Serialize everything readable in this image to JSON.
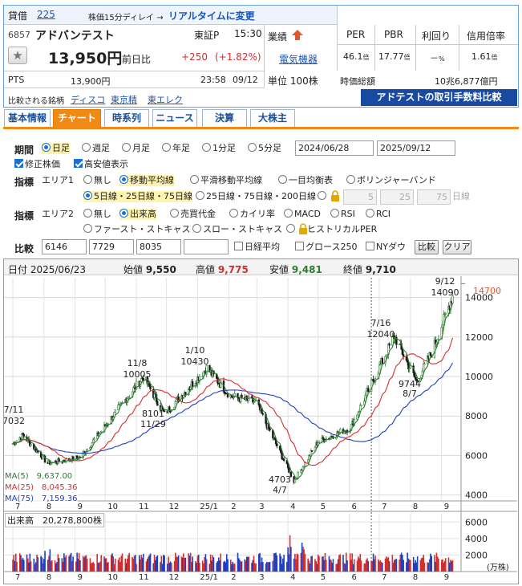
{
  "header": {
    "margin_label": "貸借",
    "margin_code": "225",
    "delay_note": "株価15分ディレイ →",
    "realtime_link": "リアルタイムに変更",
    "code": "6857",
    "name": "アドバンテスト",
    "market": "東証P",
    "time": "15:30",
    "price": "13,950円",
    "change_label": "前日比",
    "change": "+250",
    "change_pct": "(+1.82%)",
    "pts_label": "PTS",
    "pts_price": "13,900円",
    "pts_time": "23:58",
    "pts_date": "09/12",
    "performance_label": "業績",
    "sector": "電気機器",
    "unit": "単位 100株",
    "per_label": "PER",
    "pbr_label": "PBR",
    "yield_label": "利回り",
    "margin_ratio_label": "信用倍率",
    "per": "46.1",
    "pbr": "17.77",
    "yield": "－",
    "margin_ratio": "1.61",
    "ratio_unit": "倍",
    "pct_unit": "%",
    "mcap_label": "時価総額",
    "mcap": "10兆6,877億円",
    "compare_label": "比較される銘柄",
    "compare_1": "ディスコ",
    "compare_2": "東京精",
    "compare_3": "東エレク",
    "fee_banner": "アドテストの取引手数料比較"
  },
  "tabs": [
    "基本情報",
    "チャート",
    "時系列",
    "ニュース",
    "決算",
    "大株主"
  ],
  "controls": {
    "period_label": "期間",
    "periods": [
      "日足",
      "週足",
      "月足",
      "年足",
      "1分足",
      "5分足"
    ],
    "date_from": "2024/06/28",
    "date_to": "2025/09/12",
    "adjusted_label": "修正株価",
    "highlow_label": "高安値表示",
    "indicator_label": "指標",
    "area1_label": "エリア1",
    "area1_opts": [
      "無し",
      "移動平均線",
      "平滑移動平均線",
      "一目均衡表",
      "ボリンジャーバンド"
    ],
    "ma_sets": [
      "5日線・25日線・75日線",
      "25日線・75日線・200日線"
    ],
    "ma_custom": [
      "5",
      "25",
      "75"
    ],
    "day_line": "日線",
    "area2_label": "エリア2",
    "area2_opts": [
      "無し",
      "出来高",
      "売買代金",
      "カイリ率",
      "MACD",
      "RSI",
      "RCI"
    ],
    "area2_opts2": [
      "ファースト・ストキャス",
      "スロー・ストキャス",
      "ヒストリカルPER"
    ],
    "compare_label": "比較",
    "compare_codes": [
      "6146",
      "7729",
      "8035",
      ""
    ],
    "compare_opts": [
      "日経平均",
      "グロース250",
      "NYダウ"
    ],
    "compare_btn": "比較",
    "clear_btn": "クリア"
  },
  "chart_info": {
    "date_label": "日付",
    "date": "2025/06/23",
    "open_label": "始値",
    "open": "9,550",
    "high_label": "高値",
    "high": "9,775",
    "low_label": "安値",
    "low": "9,481",
    "close_label": "終値",
    "close": "9,710",
    "ma5": "MA(5)　9,637.00",
    "ma25": "MA(25)　8,045.36",
    "ma75": "MA(75)　7,159.36",
    "volume_label": "出来高　20,278,800株",
    "vol_unit": "(万株)",
    "current_price_tag": "14700",
    "colors": {
      "up": "#2e7d32",
      "down": "#1a1a1a",
      "ma5": "#2e7d32",
      "ma25": "#d32f2f",
      "ma75": "#1e3fbf",
      "vol_up": "#d32f2f",
      "vol_down": "#1e3fbf",
      "accent": "#f08a14"
    }
  },
  "chart_data": [
    {
      "type": "line",
      "title": "",
      "x": [
        "2024/07/11",
        "2024/08/05",
        "2024/09/06",
        "2024/10/01",
        "2024/11/08",
        "2024/11/29",
        "2025/01/10",
        "2025/02/03",
        "2025/02/28",
        "2025/04/07",
        "2025/05/01",
        "2025/06/02",
        "2025/07/16",
        "2025/08/07",
        "2025/08/22",
        "2025/09/12"
      ],
      "series": [
        {
          "name": "",
          "values": [
            7032,
            5600,
            5900,
            7500,
            10005,
            8101,
            10430,
            9000,
            8700,
            4703,
            6700,
            7400,
            12040,
            9744,
            11200,
            14090
          ]
        }
      ],
      "ylim": [
        3700,
        15000
      ],
      "yticks": [
        4000,
        6000,
        8000,
        10000,
        12000,
        14000
      ],
      "xticks": [
        "7",
        "8",
        "9",
        "10",
        "11",
        "12",
        "25/1",
        "2",
        "3",
        "4",
        "5",
        "6",
        "7",
        "8",
        "9"
      ],
      "annotations": [
        {
          "label": "7/11",
          "value": "7032"
        },
        {
          "label": "11/8",
          "value": "10005"
        },
        {
          "label": "8101",
          "value": "11/29"
        },
        {
          "label": "1/10",
          "value": "10430"
        },
        {
          "label": "4703",
          "value": "4/7"
        },
        {
          "label": "7/16",
          "value": "12040"
        },
        {
          "label": "9744",
          "value": "8/7"
        },
        {
          "label": "9/12",
          "value": "14090"
        }
      ],
      "grid": true
    },
    {
      "type": "bar",
      "title": "",
      "ylim": [
        0,
        7000
      ],
      "yticks": [
        2000,
        4000,
        6000
      ],
      "ylabel": "(万株)",
      "xticks": [
        "7",
        "8",
        "9",
        "10",
        "11",
        "12",
        "25/1",
        "2",
        "3",
        "4",
        "5",
        "6",
        "7",
        "8",
        "9"
      ]
    }
  ]
}
